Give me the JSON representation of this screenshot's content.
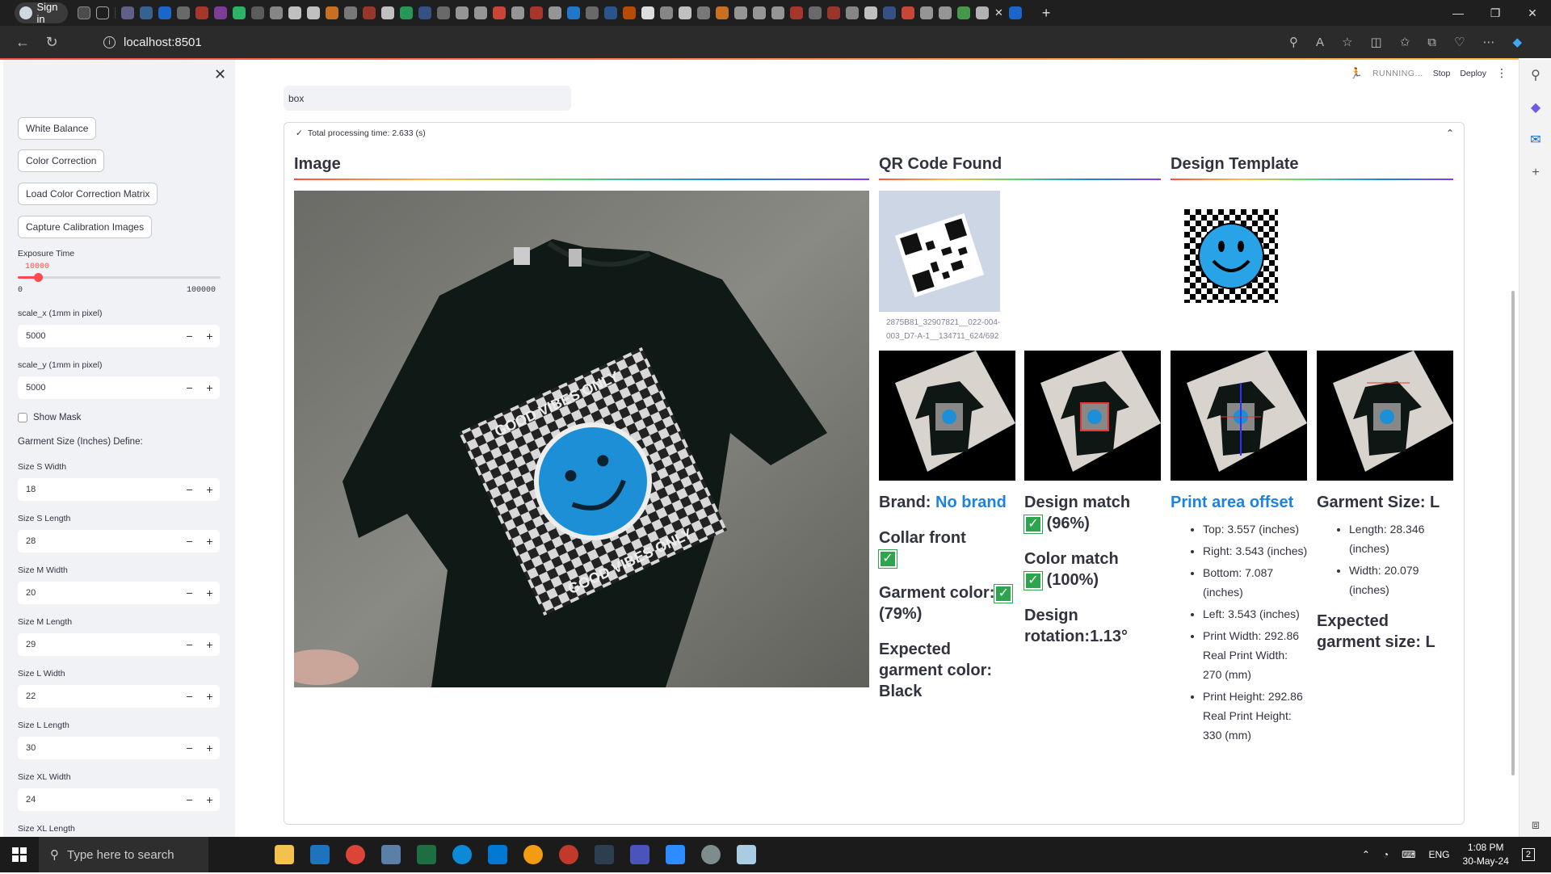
{
  "browser": {
    "sign_in_label": "Sign in",
    "url": "localhost:8501",
    "window_controls": [
      "minimize-icon",
      "restore-icon",
      "close-icon"
    ]
  },
  "toolbar": {
    "status": "RUNNING...",
    "stop_label": "Stop",
    "deploy_label": "Deploy"
  },
  "sidebar": {
    "buttons": [
      "White Balance",
      "Color Correction",
      "Load Color Correction Matrix",
      "Capture Calibration Images"
    ],
    "exposure": {
      "label": "Exposure Time",
      "value": "10000",
      "min": "0",
      "max": "100000",
      "fraction": 0.1
    },
    "scale_x": {
      "label": "scale_x (1mm in pixel)",
      "value": "5000"
    },
    "scale_y": {
      "label": "scale_y (1mm in pixel)",
      "value": "5000"
    },
    "show_mask_label": "Show Mask",
    "garment_size_header": "Garment Size (Inches) Define:",
    "sizes": [
      {
        "label": "Size S Width",
        "value": "18"
      },
      {
        "label": "Size S Length",
        "value": "28"
      },
      {
        "label": "Size M Width",
        "value": "20"
      },
      {
        "label": "Size M Length",
        "value": "29"
      },
      {
        "label": "Size L Width",
        "value": "22"
      },
      {
        "label": "Size L Length",
        "value": "30"
      },
      {
        "label": "Size XL Width",
        "value": "24"
      }
    ],
    "last_label": "Size XL Length",
    "minus": "−",
    "plus": "+"
  },
  "main": {
    "search_value": "box",
    "processing_text": "Total processing time: 2.633 (s)",
    "headers": {
      "image": "Image",
      "qr": "QR Code Found",
      "template": "Design Template"
    },
    "qr_caption_1": "2875B81_32907821__022-004-",
    "qr_caption_2": "003_D7-A-1__134711_624/692",
    "photo_text_1": "GOOD VIBES ONLY",
    "photo_text_2": "GOOD VIBES ONLY",
    "col1": {
      "brand_label": "Brand:",
      "brand_value": "No brand",
      "collar": "Collar front",
      "garment_color": "Garment color:",
      "garment_color_pct": "(79%)",
      "expected_color": "Expected garment color: Black"
    },
    "col2": {
      "design_match": "Design match",
      "design_match_pct": "(96%)",
      "color_match": "Color match",
      "color_match_pct": "(100%)",
      "design_rotation": "Design rotation:1.13°"
    },
    "col3": {
      "title": "Print area offset",
      "items": [
        "Top: 3.557 (inches)",
        "Right: 3.543 (inches)",
        "Bottom: 7.087 (inches)",
        "Left: 3.543 (inches)",
        "Print Width: 292.86 Real Print Width: 270 (mm)",
        "Print Height: 292.86 Real Print Height: 330 (mm)"
      ]
    },
    "col4": {
      "title": "Garment Size: L",
      "items": [
        "Length: 28.346 (inches)",
        "Width: 20.079 (inches)"
      ],
      "expected": "Expected garment size: L"
    },
    "check_glyph": "✓"
  },
  "taskbar": {
    "search_placeholder": "Type here to search",
    "language": "ENG",
    "time": "1:08 PM",
    "date": "30-May-24",
    "notification_count": "2"
  }
}
